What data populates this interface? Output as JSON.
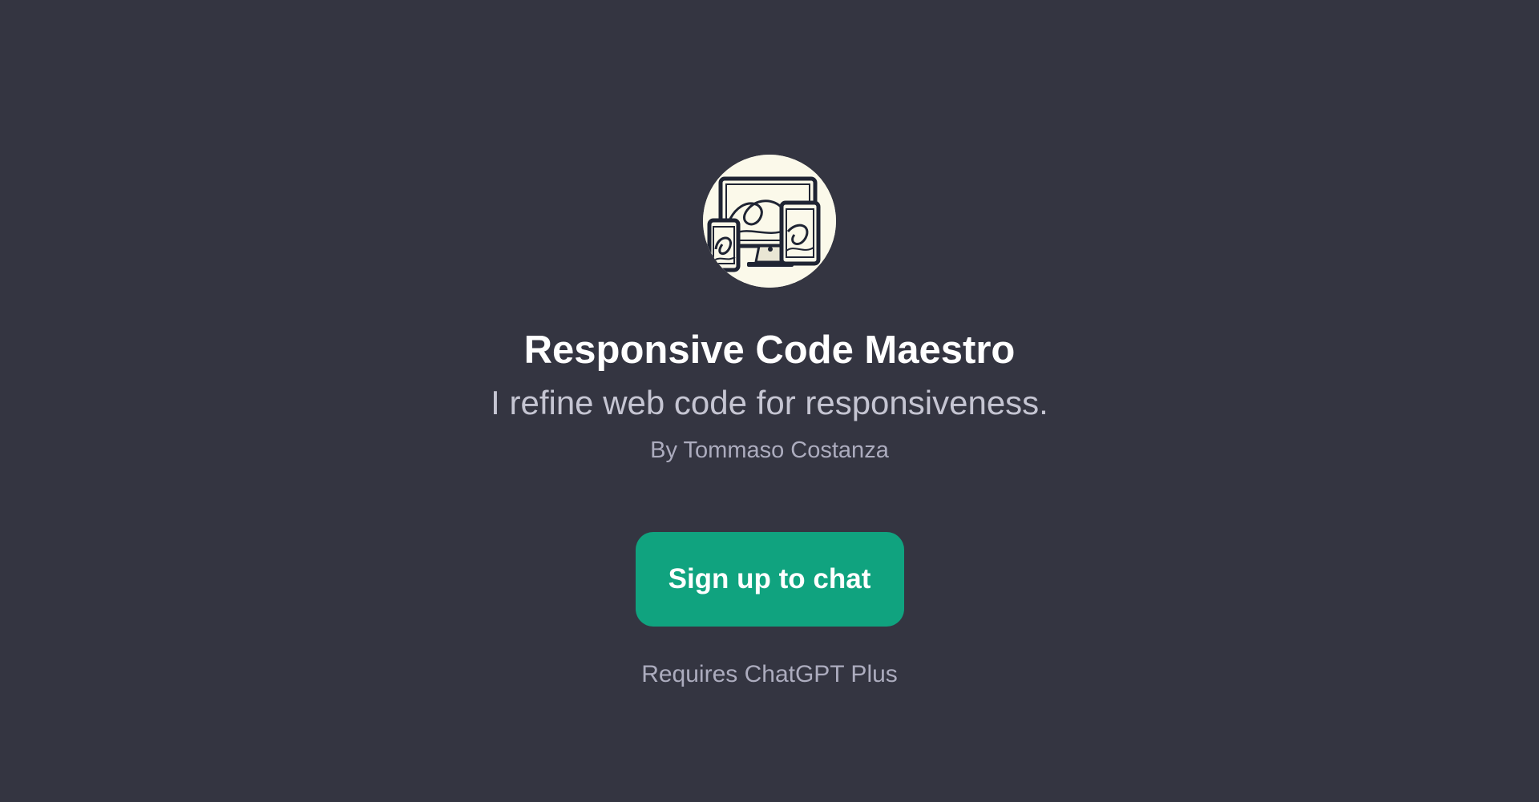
{
  "gpt": {
    "avatar_icon": "responsive-devices-icon",
    "name": "Responsive Code Maestro",
    "description": "I refine web code for responsiveness.",
    "author": "By Tommaso Costanza"
  },
  "actions": {
    "signup_label": "Sign up to chat"
  },
  "footer": {
    "requirement": "Requires ChatGPT Plus"
  },
  "colors": {
    "background": "#343541",
    "accent": "#10a37f",
    "title": "#ffffff",
    "subtitle": "#c5c5d2",
    "muted": "#acacbe",
    "avatar_bg": "#fbf9ea"
  }
}
